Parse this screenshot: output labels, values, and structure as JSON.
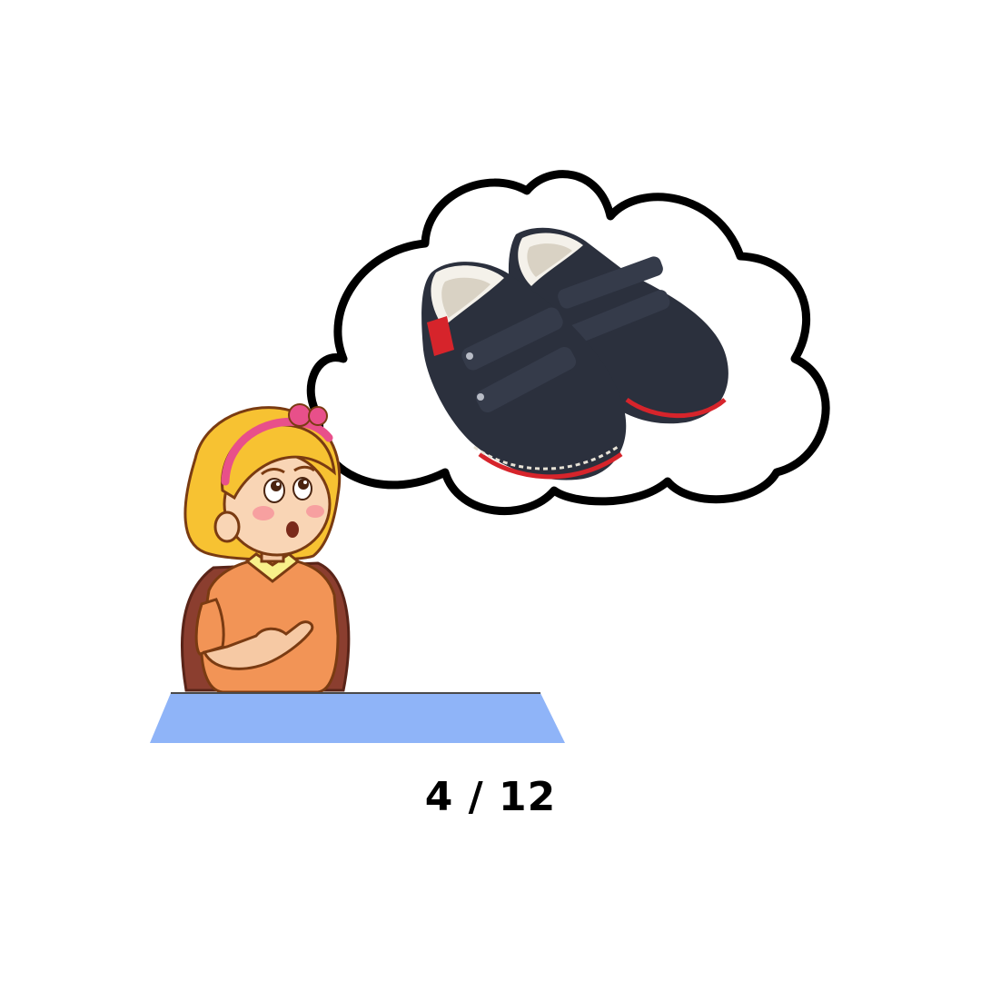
{
  "slide": {
    "current": 4,
    "total": 12,
    "counter_text": "4 / 12"
  },
  "scene": {
    "character": "girl-thinking",
    "thought_object": "shoes-icon"
  },
  "colors": {
    "desk": "#8fb4f8",
    "outline": "#000000",
    "hair": "#f7c232",
    "headband": "#e8508a",
    "shirt": "#f29456",
    "chair": "#8b3e2f",
    "shoe": "#2b303d",
    "shoe_accent": "#d6242b"
  }
}
